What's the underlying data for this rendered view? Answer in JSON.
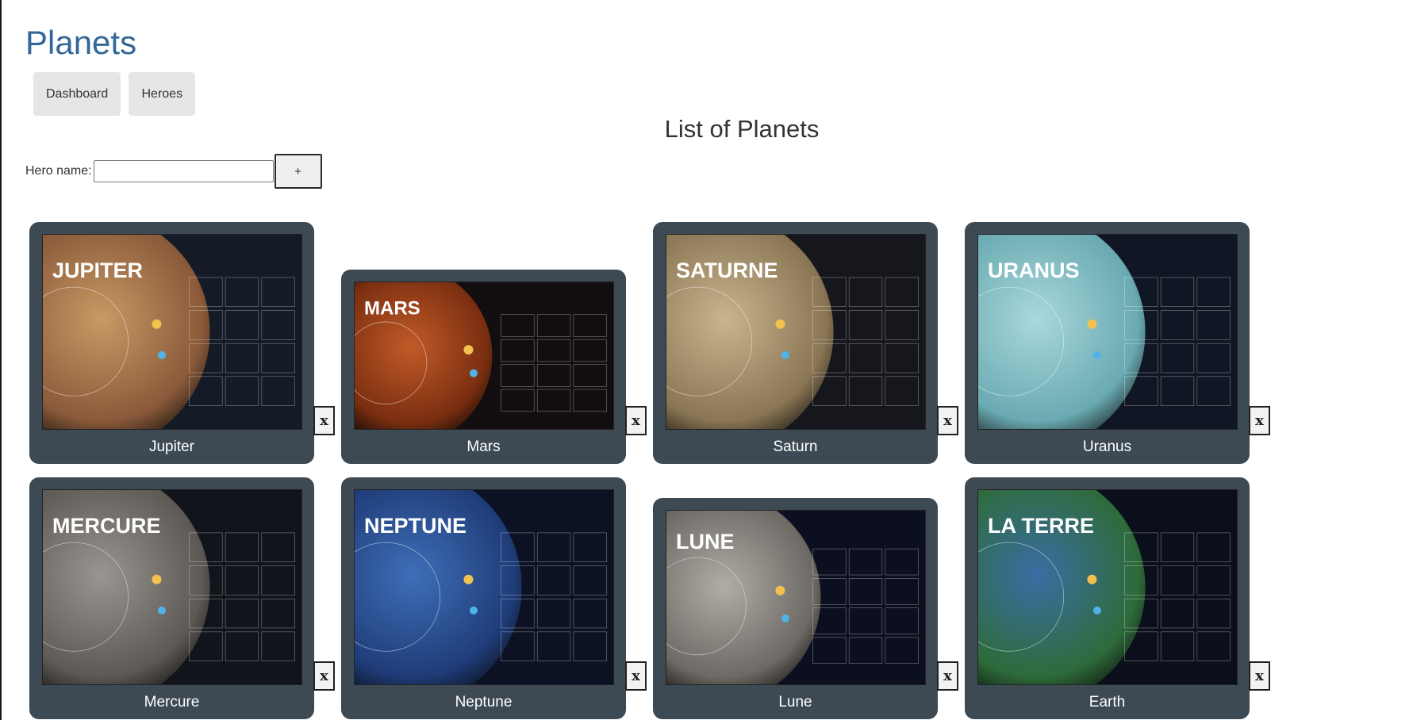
{
  "app": {
    "title": "Planets"
  },
  "nav": {
    "dashboard": "Dashboard",
    "heroes": "Heroes"
  },
  "list": {
    "title": "List of Planets"
  },
  "add_form": {
    "label": "Hero name:",
    "input_value": "",
    "add_label": "+"
  },
  "delete_label": "x",
  "planets": [
    {
      "name": "Jupiter",
      "poster_title": "JUPITER",
      "colors": {
        "base": "#c89a64",
        "band": "#8a5a3a",
        "bg": "#141a26"
      }
    },
    {
      "name": "Mars",
      "poster_title": "MARS",
      "colors": {
        "base": "#c25a28",
        "band": "#7a2e10",
        "bg": "#120e10"
      }
    },
    {
      "name": "Saturn",
      "poster_title": "SATURNE",
      "colors": {
        "base": "#c9b48e",
        "band": "#8a7654",
        "bg": "#16171c"
      }
    },
    {
      "name": "Uranus",
      "poster_title": "URANUS",
      "colors": {
        "base": "#a9d8dc",
        "band": "#6aaab2",
        "bg": "#101624"
      }
    },
    {
      "name": "Mercure",
      "poster_title": "MERCURE",
      "colors": {
        "base": "#9a9590",
        "band": "#5d5955",
        "bg": "#12141c"
      }
    },
    {
      "name": "Neptune",
      "poster_title": "NEPTUNE",
      "colors": {
        "base": "#3f6fb8",
        "band": "#1f3c78",
        "bg": "#0c1224"
      }
    },
    {
      "name": "Lune",
      "poster_title": "LUNE",
      "colors": {
        "base": "#b0aca6",
        "band": "#6d6964",
        "bg": "#0c0f1f"
      }
    },
    {
      "name": "Earth",
      "poster_title": "LA TERRE",
      "colors": {
        "base": "#3a6ea5",
        "band": "#2e6b3a",
        "bg": "#0b0f1c"
      }
    }
  ]
}
